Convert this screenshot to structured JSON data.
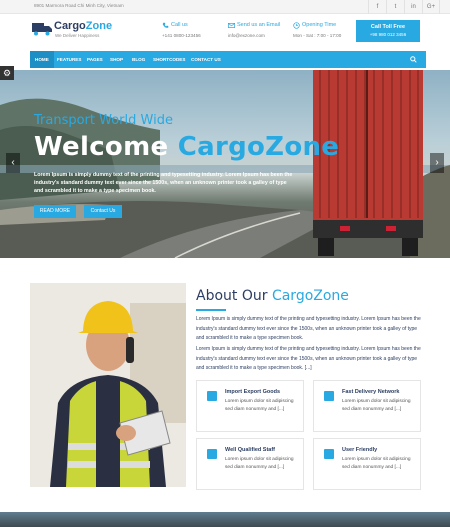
{
  "topbar": {
    "address": "8901 Marmora Road Chi Minh City, Vietnam",
    "social": [
      "f",
      "t",
      "in",
      "G+"
    ]
  },
  "brand": {
    "logo_cargo": "Cargo",
    "logo_zone": "Zone",
    "tagline": "We Deliver Happiness"
  },
  "header": {
    "call_label": "Call us",
    "call_value": "+141 0800-123456",
    "email_label": "Send us an Email",
    "email_value": "info@exzone.com",
    "hours_label": "Opening Time",
    "hours_value": "Mon - Sat : 7:00 - 17:00",
    "cta_title": "Call Toll Free",
    "cta_number": "+98 980 012 3456"
  },
  "nav": {
    "items": [
      "HOME",
      "FEATURES",
      "PAGES",
      "SHOP",
      "BLOG",
      "SHORTCODES",
      "CONTACT US"
    ]
  },
  "hero": {
    "subheading": "Transport World Wide",
    "heading_white": "Welcome",
    "heading_blue": "CargoZone",
    "paragraph": "Lorem Ipsum is simply dummy text of the printing and typesetting industry. Lorem Ipsum has been the industry's standard dummy text ever since the 1500s, when an unknown printer took a galley of type and scrambled it to make a type specimen book.",
    "button_primary": "READ MORE",
    "button_secondary": "Contact Us",
    "prev_arrow": "‹",
    "next_arrow": "›"
  },
  "about": {
    "heading_dark": "About Our",
    "heading_blue": "CargoZone",
    "para1": "Lorem Ipsum is simply dummy text of the printing and typesetting industry. Lorem Ipsum has been the industry's standard dummy text ever since the 1500s, when an unknown printer took a galley of type and scrambled it to make a type specimen book.",
    "para2": "Lorem Ipsum is simply dummy text of the printing and typesetting industry. Lorem Ipsum has been the industry's standard dummy text ever since the 1500s, when an unknown printer took a galley of type and scrambled it to make a type specimen book. [...]",
    "features": [
      {
        "title": "Import Export Goods",
        "desc": "Lorem ipsum dolor sit adipiscing sed diam nonummy and [...]",
        "icon": "box-icon"
      },
      {
        "title": "Fast Delivery Network",
        "desc": "Lorem ipsum dolor sit adipiscing sed diam nonummy and [...]",
        "icon": "truck-icon"
      },
      {
        "title": "Well Qualified Staff",
        "desc": "Lorem ipsum dolor sit adipiscing sed diam nonummy and [...]",
        "icon": "location-icon"
      },
      {
        "title": "User Friendly",
        "desc": "Lorem ipsum dolor sit adipiscing sed diam nonummy and [...]",
        "icon": "user-icon"
      }
    ]
  },
  "colors": {
    "accent": "#29a9e1",
    "dark": "#2c3e63"
  }
}
